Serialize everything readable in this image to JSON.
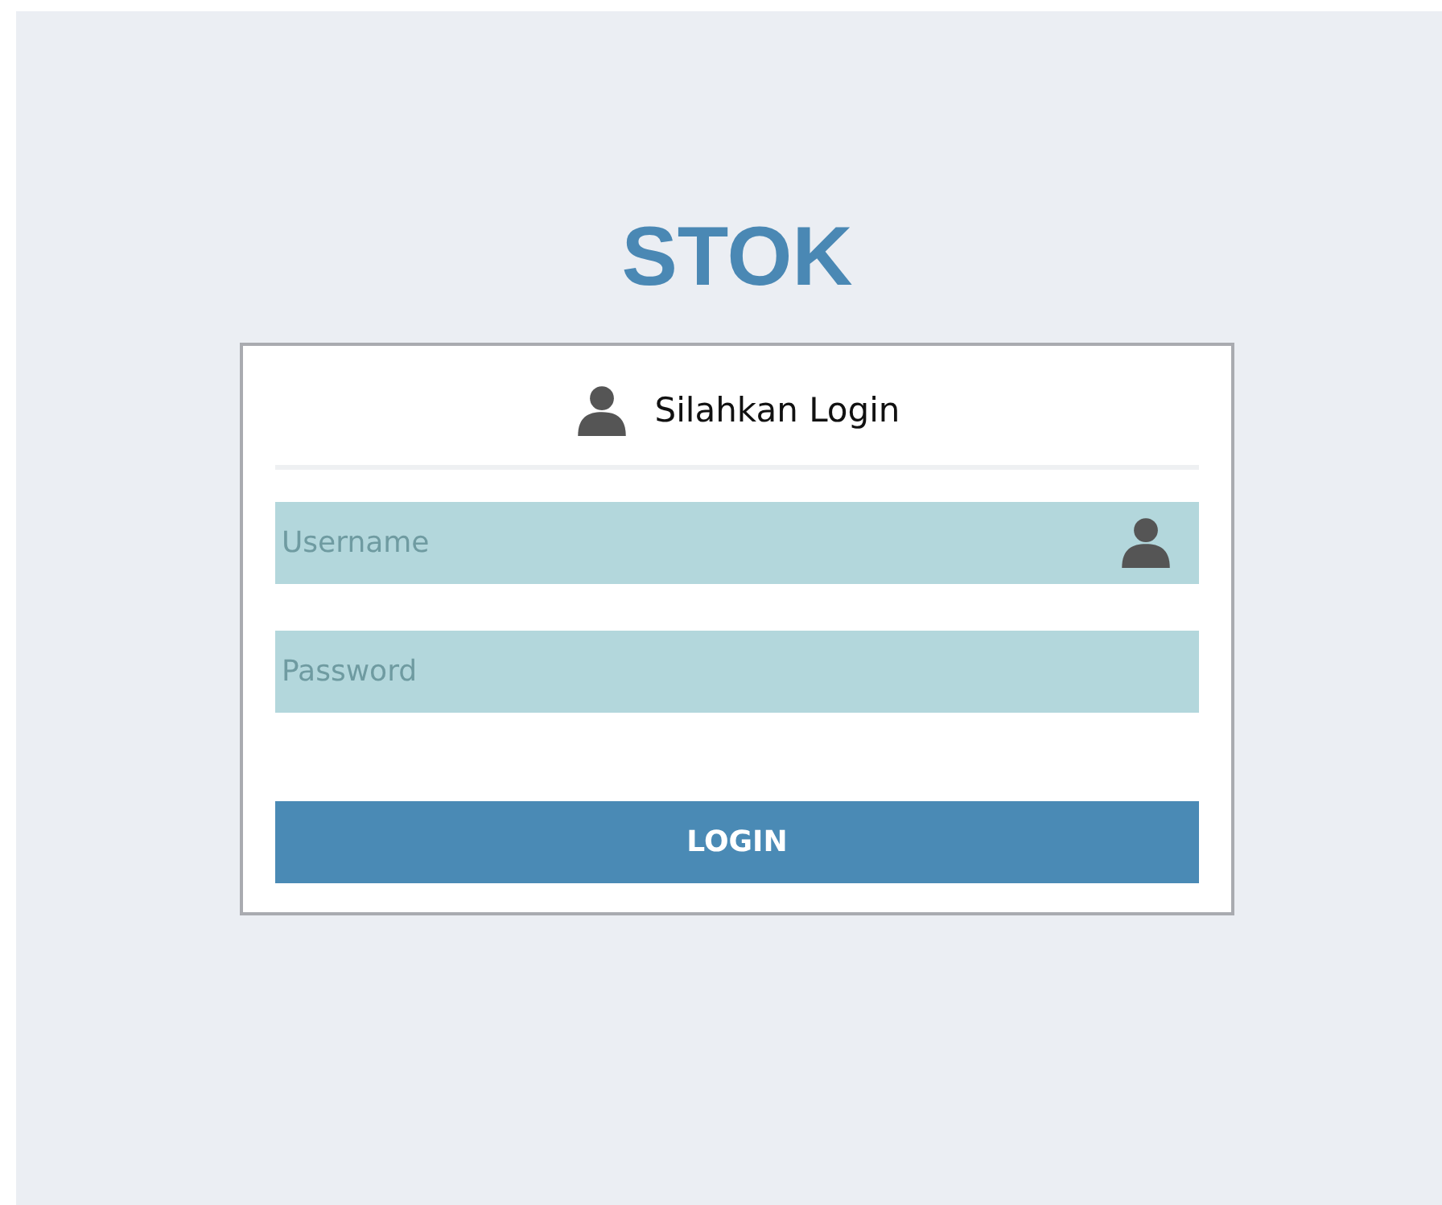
{
  "app_title": "STOK",
  "login_panel": {
    "heading": "Silahkan Login",
    "fields": [
      {
        "kind": "text",
        "placeholder": "Username"
      },
      {
        "kind": "password",
        "placeholder": "Password"
      }
    ],
    "button": "LOGIN"
  }
}
